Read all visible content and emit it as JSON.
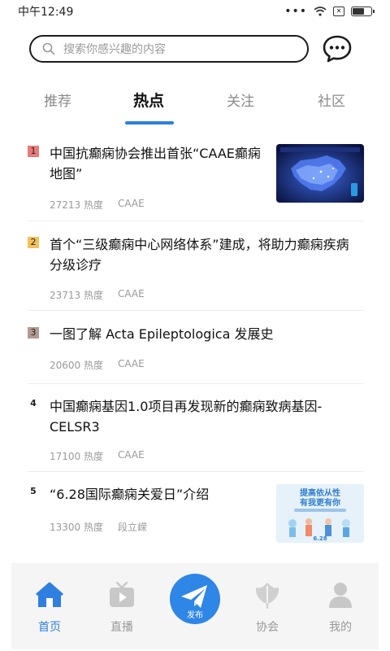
{
  "status_bar": {
    "time": "中午12:49",
    "sim_label": "✕"
  },
  "search": {
    "placeholder": "搜索你感兴趣的内容"
  },
  "tabs": [
    {
      "label": "推荐",
      "active": false
    },
    {
      "label": "热点",
      "active": true
    },
    {
      "label": "关注",
      "active": false
    },
    {
      "label": "社区",
      "active": false
    }
  ],
  "feed": [
    {
      "rank": "1",
      "title_lines": [
        "中国抗癫痫协会推出首张“CAAE癫痫",
        "地图”"
      ],
      "heat": "27213 热度",
      "source": "CAAE",
      "thumb": "map-thumbnail"
    },
    {
      "rank": "2",
      "title_lines": [
        "首个“三级癫痫中心网络体系”建成，将助力癫痫疾病",
        "分级诊疗"
      ],
      "heat": "23713 热度",
      "source": "CAAE"
    },
    {
      "rank": "3",
      "title_lines": [
        "一图了解 Acta Epileptologica 发展史"
      ],
      "heat": "20600 热度",
      "source": "CAAE"
    },
    {
      "rank": "4",
      "title_lines": [
        "中国癫痫基因1.0项目再发现新的癫痫致病基因-",
        "CELSR3"
      ],
      "heat": "17100 热度",
      "source": "CAAE"
    },
    {
      "rank": "5",
      "title_lines": [
        "“6.28国际癫痫关爱日”介绍"
      ],
      "heat": "13300 热度",
      "source": "段立嵘",
      "thumb": "poster-thumbnail"
    }
  ],
  "thumb5": {
    "line1": "提高依从性",
    "line2": "有我更有你",
    "date": "6.28"
  },
  "tabbar": {
    "home": "首页",
    "live": "直播",
    "publish": "发布",
    "association": "协会",
    "mine": "我的"
  },
  "colors": {
    "accent": "#2e7fe0",
    "rank1": "#e97a7a",
    "rank2": "#f3c15c",
    "rank3": "#b49a94"
  }
}
